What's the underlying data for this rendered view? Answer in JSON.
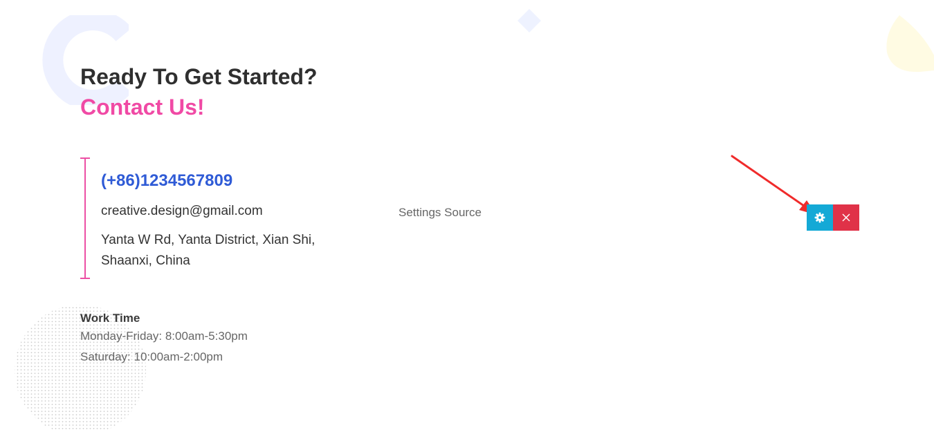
{
  "heading": {
    "line1": "Ready To Get Started?",
    "line2": "Contact Us!"
  },
  "contact": {
    "phone": "(+86)1234567809",
    "email": "creative.design@gmail.com",
    "address_line1": "Yanta W Rd, Yanta District, Xian Shi,",
    "address_line2": "Shaanxi, China"
  },
  "work_time": {
    "title": "Work Time",
    "weekdays": "Monday-Friday: 8:00am-5:30pm",
    "saturday": "Saturday: 10:00am-2:00pm"
  },
  "settings": {
    "label": "Settings Source"
  },
  "controls": {
    "settings_icon": "gear-icon",
    "close_icon": "close-icon"
  },
  "colors": {
    "heading_dark": "#2f2f2f",
    "accent_pink": "#f04aa5",
    "phone_blue": "#2f5bd6",
    "settings_button": "#14a9d6",
    "close_button": "#e03248",
    "annotation_arrow": "#f02b2b"
  }
}
